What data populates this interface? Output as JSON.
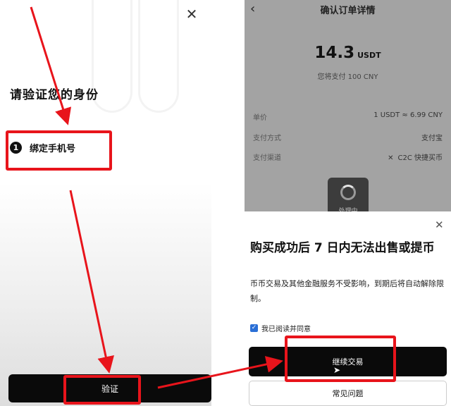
{
  "left_screen": {
    "title": "请验证您的身份",
    "step": {
      "number": "1",
      "label": "绑定手机号"
    },
    "verify_button": "验证",
    "close_icon": "close-icon"
  },
  "order_screen": {
    "title": "确认订单详情",
    "back_icon": "back-arrow-icon",
    "amount": "14.3",
    "amount_unit": "USDT",
    "pay_note": "您将支付 100 CNY",
    "rows": [
      {
        "label": "单价",
        "value": "1 USDT ≈ 6.99 CNY"
      },
      {
        "label": "支付方式",
        "value": "支付宝"
      },
      {
        "label": "支付渠道",
        "value": "C2C 快捷买币"
      }
    ],
    "channel_icon": "✕",
    "processing_label": "处理中"
  },
  "warning_sheet": {
    "title": "购买成功后 7 日内无法出售或提币",
    "description": "币币交易及其他金融服务不受影响，到期后将自动解除限制。",
    "agree_label": "我已阅读并同意",
    "agree_checked": true,
    "continue_button": "继续交易",
    "faq_button": "常见问题"
  },
  "annotation_color": "#e8141b"
}
